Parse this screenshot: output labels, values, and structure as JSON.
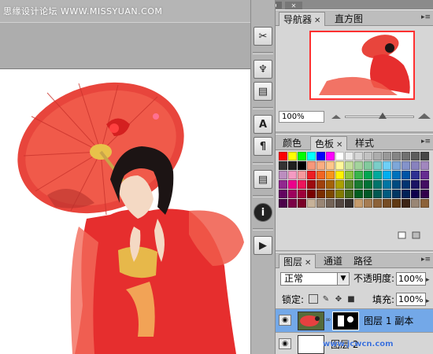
{
  "watermark": {
    "text": "思缘设计论坛 WWW.MISSYUAN.COM"
  },
  "top_bar": {
    "collapse_glyph": "◂◂",
    "close_glyph": "✕"
  },
  "toolbar": {
    "buttons": [
      {
        "icon": "crossed-tools-icon",
        "glyph": "✂"
      },
      {
        "icon": "brush-icon",
        "glyph": "♆"
      },
      {
        "icon": "stamp-icon",
        "glyph": "▤"
      },
      {
        "icon": "character-icon",
        "glyph": "A"
      },
      {
        "icon": "paragraph-icon",
        "glyph": "¶"
      },
      {
        "icon": "notes-icon",
        "glyph": "▤"
      },
      {
        "icon": "info-icon",
        "glyph": "i"
      },
      {
        "icon": "actions-play-icon",
        "glyph": "▶"
      }
    ]
  },
  "navigator_panel": {
    "tabs": [
      {
        "label": "导航器",
        "active": true,
        "closable": true
      },
      {
        "label": "直方图",
        "active": false,
        "closable": false
      }
    ],
    "zoom_value": "100%",
    "slider_level_percent": 55
  },
  "swatches_panel": {
    "tabs": [
      {
        "label": "颜色",
        "active": false,
        "closable": false
      },
      {
        "label": "色板",
        "active": true,
        "closable": true
      },
      {
        "label": "样式",
        "active": false,
        "closable": false
      }
    ],
    "colors": [
      "#ff0000",
      "#ffff00",
      "#00ff00",
      "#00ffff",
      "#0000ff",
      "#ff00ff",
      "#ffffff",
      "#ebebeb",
      "#d6d6d6",
      "#c2c2c2",
      "#adadad",
      "#999999",
      "#858585",
      "#707070",
      "#5c5c5c",
      "#474747",
      "#333333",
      "#1f1f1f",
      "#000000",
      "#f7977a",
      "#f9ad81",
      "#fdc68a",
      "#fff79a",
      "#c4df9b",
      "#a3d39c",
      "#82ca9d",
      "#7bcdc8",
      "#6ecff6",
      "#7ea7d8",
      "#8493ca",
      "#8882be",
      "#a187be",
      "#bc8dbf",
      "#f49ac2",
      "#f6989d",
      "#ed1c24",
      "#f26522",
      "#f7941d",
      "#fff200",
      "#8dc63f",
      "#39b54a",
      "#00a651",
      "#00a99d",
      "#00aeef",
      "#0072bc",
      "#0054a6",
      "#2e3192",
      "#662d91",
      "#92278f",
      "#ec008c",
      "#ed145b",
      "#9e0b0f",
      "#a0410d",
      "#a36209",
      "#aba000",
      "#598527",
      "#1a7b30",
      "#007236",
      "#00746b",
      "#0076a3",
      "#004b80",
      "#003471",
      "#1b1464",
      "#440e62",
      "#630460",
      "#9e005d",
      "#9e0039",
      "#790000",
      "#7b2e00",
      "#7d4900",
      "#827b00",
      "#406618",
      "#005e20",
      "#005826",
      "#005952",
      "#005b7f",
      "#003663",
      "#002157",
      "#0d004c",
      "#32004b",
      "#4b0049",
      "#7b0046",
      "#7a0026",
      "#c7b299",
      "#998675",
      "#736357",
      "#534741",
      "#37302d",
      "#c69c6d",
      "#a67c52",
      "#8c6239",
      "#754c24",
      "#603913",
      "#3c2415",
      "#998675",
      "#8c6239"
    ]
  },
  "layers_panel": {
    "tabs": [
      {
        "label": "图层",
        "active": true,
        "closable": true
      },
      {
        "label": "通道",
        "active": false,
        "closable": false
      },
      {
        "label": "路径",
        "active": false,
        "closable": false
      }
    ],
    "blend_mode": "正常",
    "opacity_label": "不透明度:",
    "opacity_value": "100%",
    "lock_label": "锁定:",
    "fill_label": "填充:",
    "fill_value": "100%",
    "layers": [
      {
        "name": "图层 1 副本",
        "selected": true
      },
      {
        "name": "图层 2",
        "selected": false
      }
    ]
  },
  "site_mark": "www.jcwcn.com"
}
